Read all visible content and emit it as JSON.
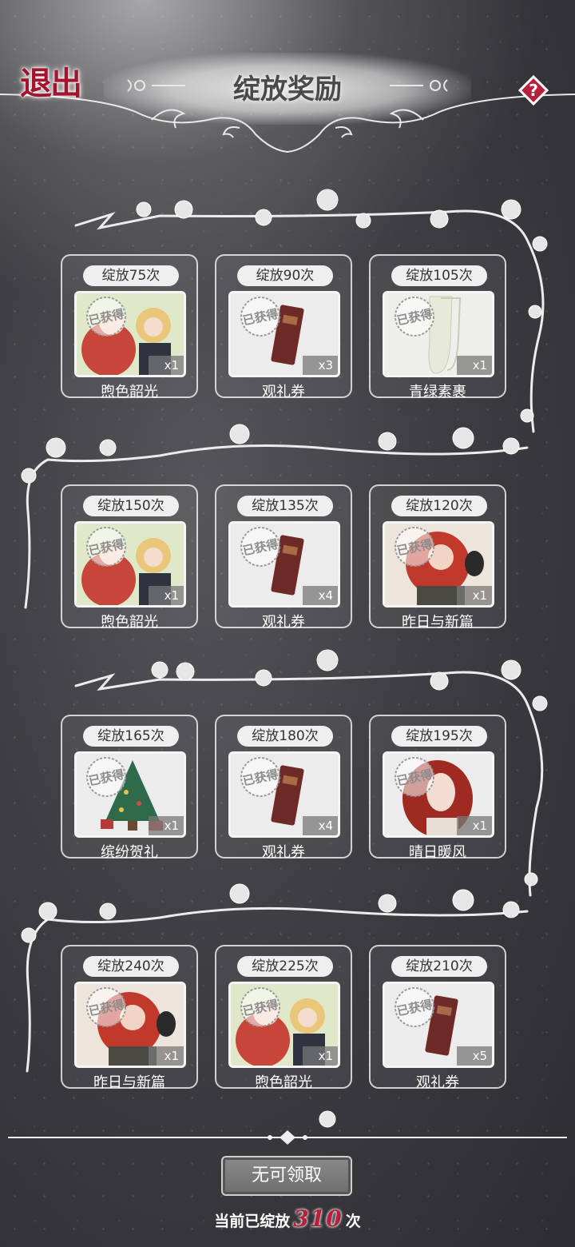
{
  "header": {
    "exit_label": "退出",
    "title": "绽放奖励",
    "help_icon": "question-icon"
  },
  "rewards": [
    {
      "req": "绽放75次",
      "name": "煦色韶光",
      "qty": "x1",
      "art": "costume-duo",
      "claimed": true
    },
    {
      "req": "绽放90次",
      "name": "观礼券",
      "qty": "x3",
      "art": "ticket",
      "claimed": true
    },
    {
      "req": "绽放105次",
      "name": "青绿素裹",
      "qty": "x1",
      "art": "stockings",
      "claimed": true
    },
    {
      "req": "绽放150次",
      "name": "煦色韶光",
      "qty": "x1",
      "art": "costume-duo",
      "claimed": true
    },
    {
      "req": "绽放135次",
      "name": "观礼券",
      "qty": "x4",
      "art": "ticket",
      "claimed": true
    },
    {
      "req": "绽放120次",
      "name": "昨日与新篇",
      "qty": "x1",
      "art": "redhead-crow",
      "claimed": true
    },
    {
      "req": "绽放165次",
      "name": "缤纷贺礼",
      "qty": "x1",
      "art": "christmas-tree",
      "claimed": true
    },
    {
      "req": "绽放180次",
      "name": "观礼券",
      "qty": "x4",
      "art": "ticket",
      "claimed": true
    },
    {
      "req": "绽放195次",
      "name": "晴日暖风",
      "qty": "x1",
      "art": "hair-portrait",
      "claimed": true
    },
    {
      "req": "绽放240次",
      "name": "昨日与新篇",
      "qty": "x1",
      "art": "redhead-crow",
      "claimed": true
    },
    {
      "req": "绽放225次",
      "name": "煦色韶光",
      "qty": "x1",
      "art": "costume-duo",
      "claimed": true
    },
    {
      "req": "绽放210次",
      "name": "观礼券",
      "qty": "x5",
      "art": "ticket",
      "claimed": true
    }
  ],
  "stamp_label": "已获得",
  "claim_button": "无可领取",
  "counter": {
    "prefix": "当前已绽放",
    "value": "310",
    "suffix": "次"
  },
  "colors": {
    "accent_red": "#b6203a",
    "background": "#3e3e42"
  }
}
